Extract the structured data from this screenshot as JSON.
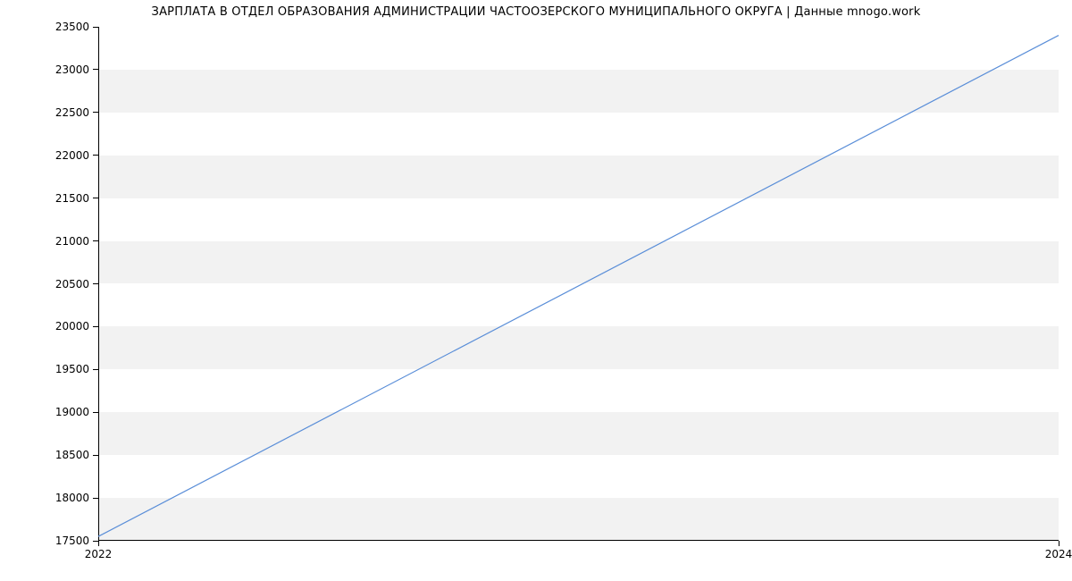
{
  "chart_data": {
    "type": "line",
    "title": "ЗАРПЛАТА В ОТДЕЛ ОБРАЗОВАНИЯ АДМИНИСТРАЦИИ ЧАСТООЗЕРСКОГО МУНИЦИПАЛЬНОГО ОКРУГА | Данные mnogo.work",
    "xlabel": "",
    "ylabel": "",
    "x": [
      2022,
      2024
    ],
    "values": [
      17550,
      23400
    ],
    "x_ticks": [
      2022,
      2024
    ],
    "x_tick_labels": [
      "2022",
      "2024"
    ],
    "y_ticks": [
      17500,
      18000,
      18500,
      19000,
      19500,
      20000,
      20500,
      21000,
      21500,
      22000,
      22500,
      23000,
      23500
    ],
    "y_tick_labels": [
      "17500",
      "18000",
      "18500",
      "19000",
      "19500",
      "20000",
      "20500",
      "21000",
      "21500",
      "22000",
      "22500",
      "23000",
      "23500"
    ],
    "xlim": [
      2022,
      2024
    ],
    "ylim": [
      17500,
      23500
    ],
    "line_color": "#5a8ed8",
    "grid_band_color": "#f2f2f2"
  }
}
